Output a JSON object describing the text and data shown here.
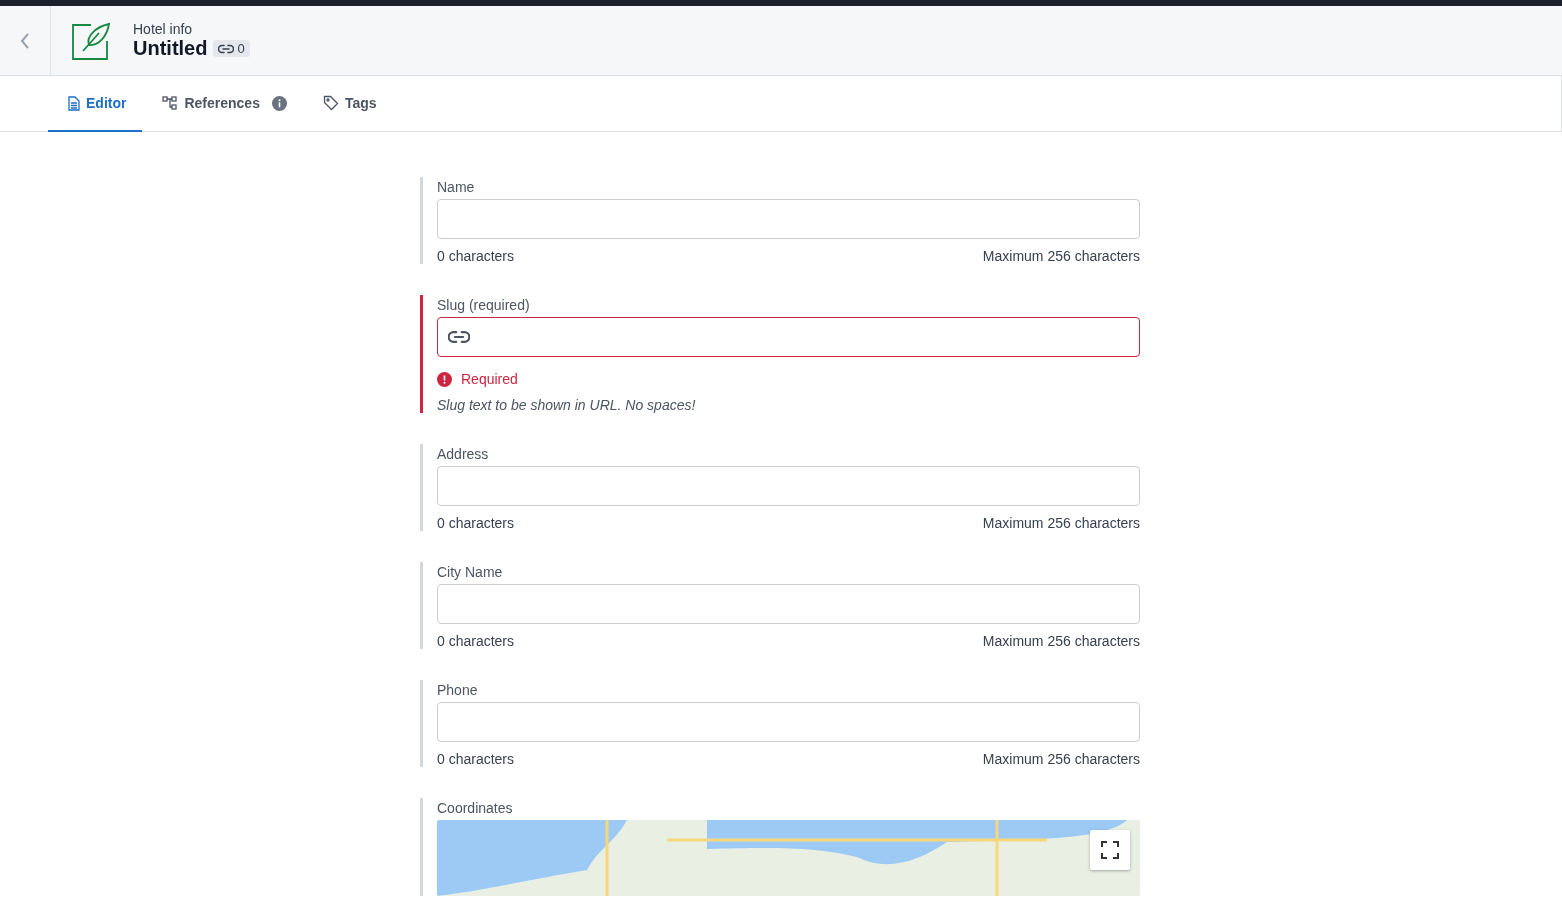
{
  "header": {
    "subtitle": "Hotel info",
    "title": "Untitled",
    "reference_count": "0"
  },
  "tabs": [
    {
      "label": "Editor",
      "selected": true,
      "kind": "editor"
    },
    {
      "label": "References",
      "selected": false,
      "kind": "references"
    },
    {
      "label": "Tags",
      "selected": false,
      "kind": "tags"
    }
  ],
  "fields": [
    {
      "kind": "text",
      "label": "Name",
      "invalid": false,
      "count": "0 characters",
      "limit": "Maximum 256 characters"
    },
    {
      "kind": "slug",
      "label": "Slug (required)",
      "invalid": true,
      "error": "Required",
      "description": "Slug text to be shown in URL. No spaces!"
    },
    {
      "kind": "text",
      "label": "Address",
      "invalid": false,
      "count": "0 characters",
      "limit": "Maximum 256 characters"
    },
    {
      "kind": "text",
      "label": "City Name",
      "invalid": false,
      "count": "0 characters",
      "limit": "Maximum 256 characters"
    },
    {
      "kind": "text",
      "label": "Phone",
      "invalid": false,
      "count": "0 characters",
      "limit": "Maximum 256 characters"
    },
    {
      "kind": "map",
      "label": "Coordinates",
      "invalid": false
    }
  ]
}
